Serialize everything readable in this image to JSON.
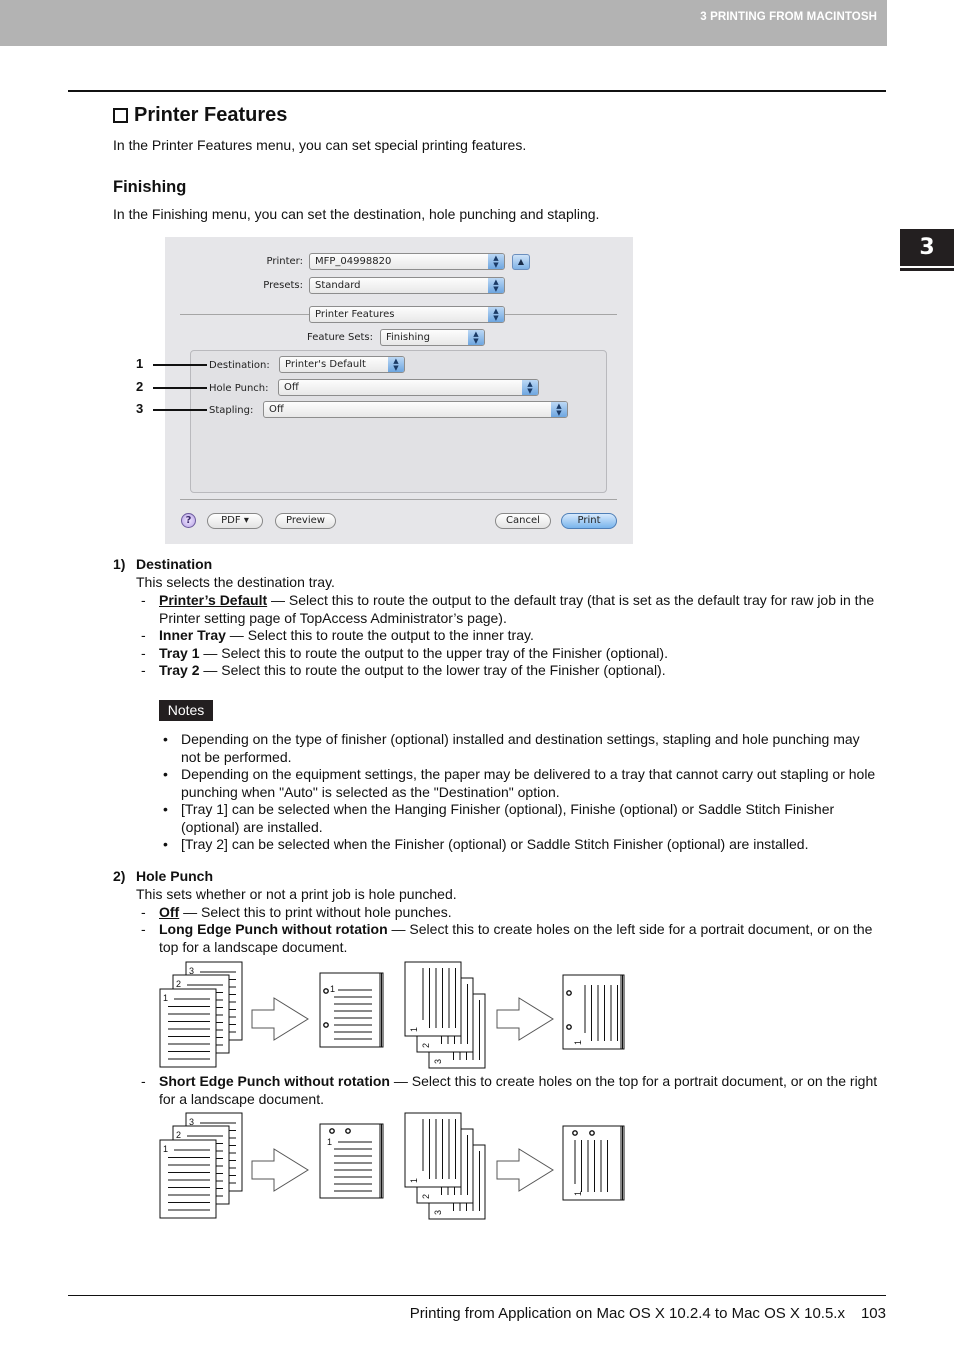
{
  "header": {
    "chapter_title": "3 PRINTING FROM MACINTOSH",
    "chapter_tab": "3"
  },
  "section": {
    "title": "Printer Features",
    "intro": "In the Printer Features menu, you can set special printing features."
  },
  "finishing": {
    "title": "Finishing",
    "intro": "In the Finishing menu, you can set the destination, hole punching and stapling."
  },
  "dialog": {
    "printer_label": "Printer:",
    "printer_value": "MFP_04998820",
    "presets_label": "Presets:",
    "presets_value": "Standard",
    "panel_value": "Printer Features",
    "feature_sets_label": "Feature Sets:",
    "feature_sets_value": "Finishing",
    "destination_label": "Destination:",
    "destination_value": "Printer's Default",
    "hole_punch_label": "Hole Punch:",
    "hole_punch_value": "Off",
    "stapling_label": "Stapling:",
    "stapling_value": "Off",
    "help_label": "?",
    "pdf_label": "PDF ▾",
    "preview_label": "Preview",
    "cancel_label": "Cancel",
    "print_label": "Print",
    "eject_glyph": "▲",
    "popup_arrows": "▲\n▼"
  },
  "callouts": [
    "1",
    "2",
    "3"
  ],
  "destination": {
    "number": "1)",
    "title": "Destination",
    "desc": "This selects the destination tray.",
    "options": [
      {
        "name": "Printer’s Default",
        "underline": true,
        "text": " — Select this to route the output to the default tray (that is set as the default tray for raw job in the Printer setting page of TopAccess Administrator’s page)."
      },
      {
        "name": "Inner Tray",
        "underline": false,
        "text": " — Select this to route the output to the inner tray."
      },
      {
        "name": "Tray 1",
        "underline": false,
        "text": " — Select this to route the output to the upper tray of the Finisher (optional)."
      },
      {
        "name": "Tray 2",
        "underline": false,
        "text": " — Select this to route the output to the lower tray of the Finisher (optional)."
      }
    ]
  },
  "notes": {
    "badge": "Notes",
    "items": [
      "Depending on the type of finisher (optional) installed and destination settings, stapling and hole punching may not be performed.",
      "Depending on the equipment settings, the paper may be delivered to a tray that cannot carry out stapling or hole punching when \"Auto\" is selected as the \"Destination\" option.",
      "[Tray 1] can be selected when the Hanging Finisher (optional), Finishe (optional) or Saddle Stitch Finisher (optional) are installed.",
      "[Tray 2] can be selected when the Finisher (optional) or Saddle Stitch Finisher (optional) are installed."
    ]
  },
  "hole_punch": {
    "number": "2)",
    "title": "Hole Punch",
    "desc": "This sets whether or not a print job is hole punched.",
    "options": [
      {
        "name": "Off",
        "underline": true,
        "text": " — Select this to print without hole punches."
      },
      {
        "name": "Long Edge Punch without rotation",
        "underline": false,
        "text": " — Select this to create holes on the left side for a portrait document, or on the top for a landscape document."
      },
      {
        "name": "Short Edge Punch without rotation",
        "underline": false,
        "text": " — Select this to create holes on the top for a portrait document, or on the right for a landscape document."
      }
    ],
    "page_numbers": [
      "1",
      "2",
      "3"
    ]
  },
  "footer": {
    "title": "Printing from Application on Mac OS X 10.2.4 to Mac OS X 10.5.x",
    "page": "103"
  }
}
